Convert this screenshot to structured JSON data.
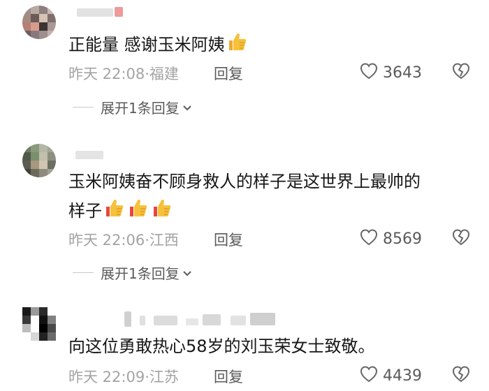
{
  "comments": [
    {
      "text_line1": "正能量 感谢玉米阿姨",
      "time": "昨天 22:08",
      "location": "福建",
      "reply_label": "回复",
      "likes": "3643",
      "expand_label": "展开1条回复"
    },
    {
      "text_line1": "玉米阿姨奋不顾身救人的样子是这世界上最帅的",
      "text_line2": "样子",
      "time": "昨天 22:06",
      "location": "江西",
      "reply_label": "回复",
      "likes": "8569",
      "expand_label": "展开1条回复"
    },
    {
      "text_line1": "向这位勇敢热心58岁的刘玉荣女士致敬。",
      "time": "昨天 22:09",
      "location": "江苏",
      "reply_label": "回复",
      "likes": "4439"
    }
  ],
  "meta_separator": "·",
  "icons": {
    "like": "heart-outline-icon",
    "dislike": "broken-heart-icon",
    "expand": "chevron-down-icon",
    "emoji": "thumbs-up-emoji"
  },
  "colors": {
    "text": "#161616",
    "meta": "#a3a3a3",
    "action": "#5a5a5a",
    "emoji_yellow": "#f6c13b",
    "emoji_red": "#e8463a"
  }
}
